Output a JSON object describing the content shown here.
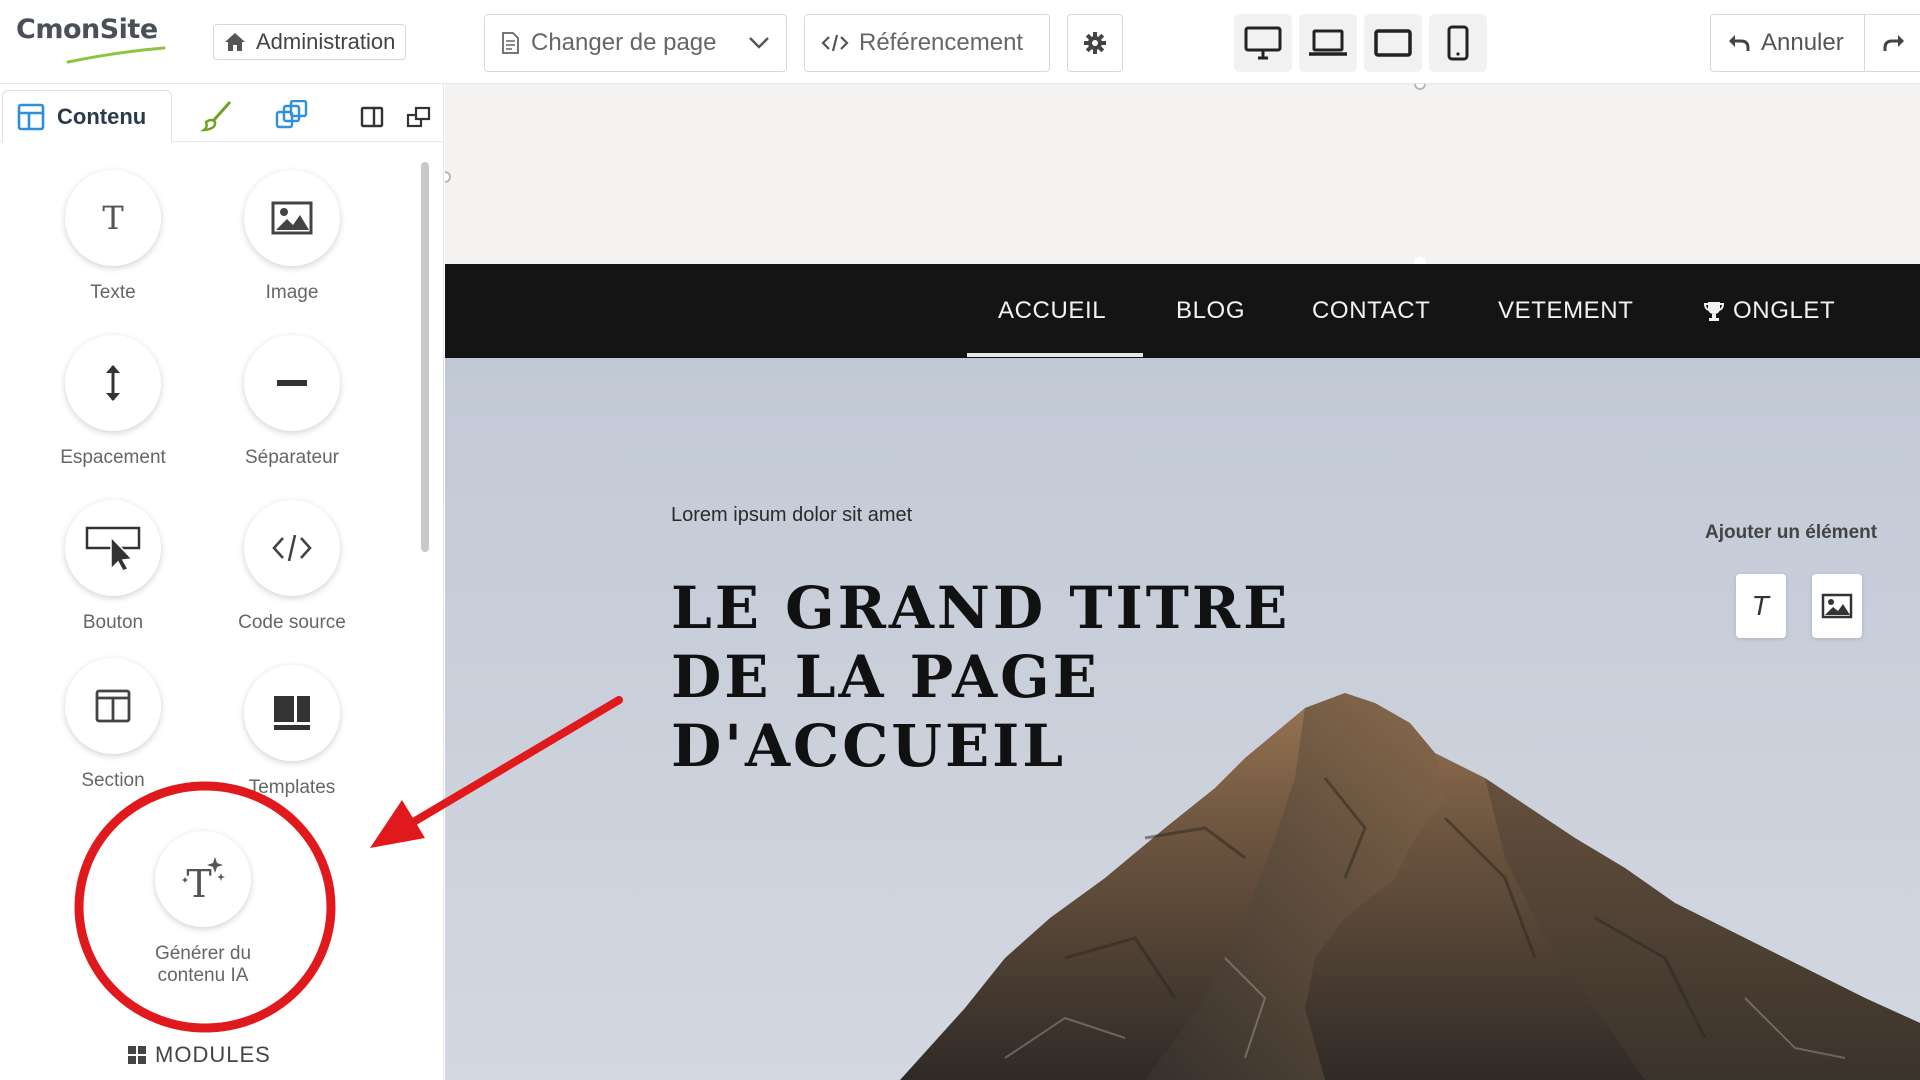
{
  "app": {
    "logo": "CmonSite",
    "admin_label": "Administration",
    "change_page_label": "Changer de page",
    "seo_label": "Référencement",
    "undo_label": "Annuler"
  },
  "sidebar": {
    "tab_content_label": "Contenu",
    "tools": [
      {
        "label": "Texte",
        "icon": "text-icon"
      },
      {
        "label": "Image",
        "icon": "image-icon"
      },
      {
        "label": "Espacement",
        "icon": "spacing-icon"
      },
      {
        "label": "Séparateur",
        "icon": "separator-icon"
      },
      {
        "label": "Bouton",
        "icon": "button-cursor-icon"
      },
      {
        "label": "Code source",
        "icon": "code-icon"
      },
      {
        "label": "Section",
        "icon": "section-icon"
      },
      {
        "label": "Templates",
        "icon": "templates-icon"
      },
      {
        "label": "Générer du contenu IA",
        "icon": "ai-text-icon"
      }
    ],
    "modules_label": "MODULES"
  },
  "canvas": {
    "nav": [
      "ACCUEIL",
      "BLOG",
      "CONTACT",
      "VETEMENT",
      "ONGLET"
    ],
    "active_nav": "ACCUEIL",
    "hero_subtitle": "Lorem ipsum dolor sit amet",
    "hero_title_lines": [
      "LE GRAND TITRE",
      "DE LA PAGE",
      "D'ACCUEIL"
    ],
    "add_element_label": "Ajouter un élément"
  },
  "colors": {
    "annotation_red": "#e0191c",
    "navbar_bg": "#141414",
    "brush_green": "#6fa31f",
    "tab_blue": "#2f8fd8"
  }
}
